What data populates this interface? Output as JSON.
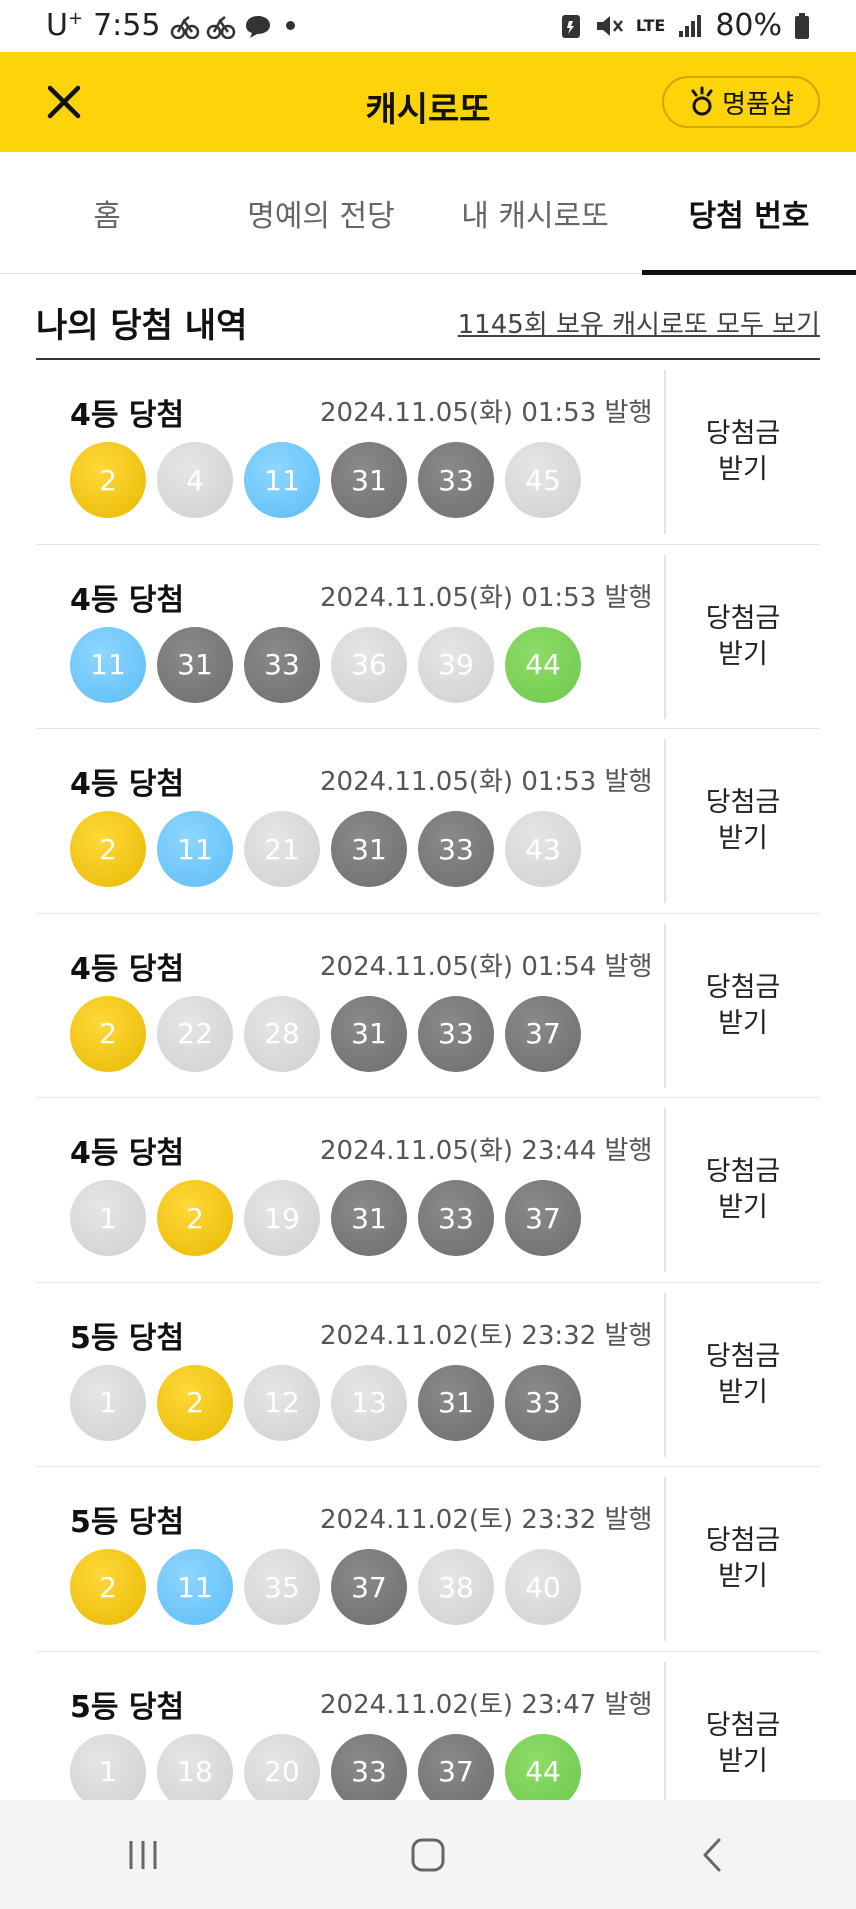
{
  "status_bar": {
    "carrier": "U",
    "carrier_sup": "+",
    "time": "7:55",
    "network": "LTE",
    "battery": "80%"
  },
  "header": {
    "title": "캐시로또",
    "shop_label": "명품샵",
    "accent_color": "#fdd30a"
  },
  "tabs": [
    {
      "label": "홈",
      "active": false
    },
    {
      "label": "명예의 전당",
      "active": false
    },
    {
      "label": "내 캐시로또",
      "active": false
    },
    {
      "label": "당첨 번호",
      "active": true
    }
  ],
  "section": {
    "title": "나의 당첨 내역",
    "link": "1145회 보유 캐시로또 모두 보기"
  },
  "wins": [
    {
      "rank": "4등 당첨",
      "issued": "2024.11.05(화) 01:53 발행",
      "claim_line1": "당첨금",
      "claim_line2": "받기",
      "balls": [
        {
          "n": "2",
          "c": "y"
        },
        {
          "n": "4",
          "c": "r"
        },
        {
          "n": "11",
          "c": "b"
        },
        {
          "n": "31",
          "c": "k"
        },
        {
          "n": "33",
          "c": "k"
        },
        {
          "n": "45",
          "c": "r"
        }
      ]
    },
    {
      "rank": "4등 당첨",
      "issued": "2024.11.05(화) 01:53 발행",
      "claim_line1": "당첨금",
      "claim_line2": "받기",
      "balls": [
        {
          "n": "11",
          "c": "b"
        },
        {
          "n": "31",
          "c": "k"
        },
        {
          "n": "33",
          "c": "k"
        },
        {
          "n": "36",
          "c": "r"
        },
        {
          "n": "39",
          "c": "r"
        },
        {
          "n": "44",
          "c": "g"
        }
      ]
    },
    {
      "rank": "4등 당첨",
      "issued": "2024.11.05(화) 01:53 발행",
      "claim_line1": "당첨금",
      "claim_line2": "받기",
      "balls": [
        {
          "n": "2",
          "c": "y"
        },
        {
          "n": "11",
          "c": "b"
        },
        {
          "n": "21",
          "c": "r"
        },
        {
          "n": "31",
          "c": "k"
        },
        {
          "n": "33",
          "c": "k"
        },
        {
          "n": "43",
          "c": "r"
        }
      ]
    },
    {
      "rank": "4등 당첨",
      "issued": "2024.11.05(화) 01:54 발행",
      "claim_line1": "당첨금",
      "claim_line2": "받기",
      "balls": [
        {
          "n": "2",
          "c": "y"
        },
        {
          "n": "22",
          "c": "r"
        },
        {
          "n": "28",
          "c": "r"
        },
        {
          "n": "31",
          "c": "k"
        },
        {
          "n": "33",
          "c": "k"
        },
        {
          "n": "37",
          "c": "k"
        }
      ]
    },
    {
      "rank": "4등 당첨",
      "issued": "2024.11.05(화) 23:44 발행",
      "claim_line1": "당첨금",
      "claim_line2": "받기",
      "balls": [
        {
          "n": "1",
          "c": "r"
        },
        {
          "n": "2",
          "c": "y"
        },
        {
          "n": "19",
          "c": "r"
        },
        {
          "n": "31",
          "c": "k"
        },
        {
          "n": "33",
          "c": "k"
        },
        {
          "n": "37",
          "c": "k"
        }
      ]
    },
    {
      "rank": "5등 당첨",
      "issued": "2024.11.02(토) 23:32 발행",
      "claim_line1": "당첨금",
      "claim_line2": "받기",
      "balls": [
        {
          "n": "1",
          "c": "r"
        },
        {
          "n": "2",
          "c": "y"
        },
        {
          "n": "12",
          "c": "r"
        },
        {
          "n": "13",
          "c": "r"
        },
        {
          "n": "31",
          "c": "k"
        },
        {
          "n": "33",
          "c": "k"
        }
      ]
    },
    {
      "rank": "5등 당첨",
      "issued": "2024.11.02(토) 23:32 발행",
      "claim_line1": "당첨금",
      "claim_line2": "받기",
      "balls": [
        {
          "n": "2",
          "c": "y"
        },
        {
          "n": "11",
          "c": "b"
        },
        {
          "n": "35",
          "c": "r"
        },
        {
          "n": "37",
          "c": "k"
        },
        {
          "n": "38",
          "c": "r"
        },
        {
          "n": "40",
          "c": "r"
        }
      ]
    },
    {
      "rank": "5등 당첨",
      "issued": "2024.11.02(토) 23:47 발행",
      "claim_line1": "당첨금",
      "claim_line2": "받기",
      "balls": [
        {
          "n": "1",
          "c": "r"
        },
        {
          "n": "18",
          "c": "r"
        },
        {
          "n": "20",
          "c": "r"
        },
        {
          "n": "33",
          "c": "k"
        },
        {
          "n": "37",
          "c": "k"
        },
        {
          "n": "44",
          "c": "g"
        }
      ]
    }
  ]
}
